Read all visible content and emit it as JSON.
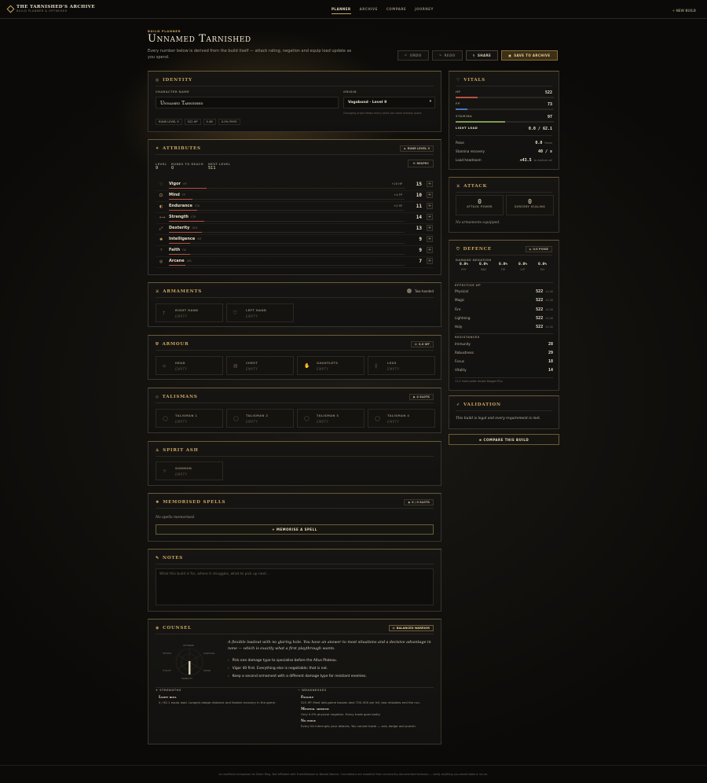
{
  "brand": {
    "title": "The Tarnished's Archive",
    "subtitle": "Build Planner & Optimiser"
  },
  "nav": {
    "links": [
      "Planner",
      "Archive",
      "Compare",
      "Journey"
    ],
    "active": "Planner",
    "new_build": "New Build"
  },
  "header": {
    "eyebrow": "Build Planner",
    "title": "Unnamed Tarnished",
    "lede": "Every number below is derived from the build itself — attack rating, negation and equip load update as you spend.",
    "buttons": {
      "undo": "Undo",
      "redo": "Redo",
      "share": "Share",
      "save": "Save to Archive"
    }
  },
  "identity": {
    "title": "Identity",
    "name_label": "Character Name",
    "name_value": "Unnamed Tarnished",
    "origin_label": "Origin",
    "origin_value": "Vagabond · Level 9",
    "origin_hint": "Changing origin keeps every point you have already spent.",
    "chips": [
      "Rune Level 9",
      "522 HP",
      "0 AR",
      "0.0% Phys"
    ]
  },
  "attributes": {
    "title": "Attributes",
    "badge": "Rune Level 9",
    "level_label": "Level",
    "level_value": "9",
    "runes_label": "Runes to reach",
    "runes_value": "0",
    "next_label": "Next level",
    "next_value": "511",
    "respec": "Respec",
    "rows": [
      {
        "name": "Vigor",
        "sub": "HP",
        "bonus": "+25 HP",
        "value": "15",
        "fill": 0.16
      },
      {
        "name": "Mind",
        "sub": "FP",
        "bonus": "+4 FP",
        "value": "10",
        "fill": 0.1
      },
      {
        "name": "Endurance",
        "sub": "STA",
        "bonus": "+2 SP",
        "value": "11",
        "fill": 0.12
      },
      {
        "name": "Strength",
        "sub": "STR",
        "bonus": "",
        "value": "14",
        "fill": 0.15
      },
      {
        "name": "Dexterity",
        "sub": "DEX",
        "bonus": "",
        "value": "13",
        "fill": 0.14
      },
      {
        "name": "Intelligence",
        "sub": "INT",
        "bonus": "",
        "value": "9",
        "fill": 0.09
      },
      {
        "name": "Faith",
        "sub": "FAI",
        "bonus": "",
        "value": "9",
        "fill": 0.09
      },
      {
        "name": "Arcane",
        "sub": "ARC",
        "bonus": "",
        "value": "7",
        "fill": 0.07
      }
    ]
  },
  "armaments": {
    "title": "Armaments",
    "toggle": "Two-handed",
    "slots": [
      {
        "name": "Right Hand",
        "value": "Empty"
      },
      {
        "name": "Left Hand",
        "value": "Empty"
      }
    ]
  },
  "armour": {
    "title": "Armour",
    "badge": "0.0 WT",
    "slots": [
      {
        "name": "Head",
        "value": "Empty"
      },
      {
        "name": "Chest",
        "value": "Empty"
      },
      {
        "name": "Gauntlets",
        "value": "Empty"
      },
      {
        "name": "Legs",
        "value": "Empty"
      }
    ]
  },
  "talismans": {
    "title": "Talismans",
    "badge": "4 Slots",
    "slots": [
      {
        "name": "Talisman 1",
        "value": "Empty"
      },
      {
        "name": "Talisman 2",
        "value": "Empty"
      },
      {
        "name": "Talisman 3",
        "value": "Empty"
      },
      {
        "name": "Talisman 4",
        "value": "Empty"
      }
    ]
  },
  "spirit": {
    "title": "Spirit Ash",
    "slot": {
      "name": "Summon",
      "value": "Empty"
    }
  },
  "spells": {
    "title": "Memorised Spells",
    "badge": "0 / 0 Slots",
    "empty": "No spells memorised.",
    "button": "+ Memorise a Spell"
  },
  "notes": {
    "title": "Notes",
    "placeholder": "What this build is for, where it struggles, what to pick up next..."
  },
  "counsel": {
    "title": "Counsel",
    "badge": "Balanced Warrior",
    "intro": "A flexible loadout with no glaring hole. You have an answer to most situations and a decisive advantage in none — which is exactly what a first playthrough wants.",
    "radar": [
      "Offense",
      "Survival",
      "Poise",
      "Mobility",
      "Utility",
      "Status"
    ],
    "tips": [
      "Pick one damage type to specialise before the Altus Plateau.",
      "Vigor 40 first. Everything else is negotiable; that is not.",
      "Keep a second armament with a different damage type for resistant enemies."
    ],
    "strengths_label": "Strengths",
    "weaknesses_label": "Weaknesses",
    "strengths": [
      {
        "h": "Light roll",
        "d": "0 / 62.1 equip load. Longest dodge distance and fastest recovery in the game."
      }
    ],
    "weaknesses": [
      {
        "h": "Fragile",
        "d": "522 HP. Most late-game bosses deal 700–900 per hit; two mistakes end the run."
      },
      {
        "h": "Minimal armour",
        "d": "Only 0.0% physical negation. Every trade goes badly."
      },
      {
        "h": "No poise",
        "d": "Every hit interrupts your attacks. You cannot trade — only dodge and punish."
      }
    ]
  },
  "vitals": {
    "title": "Vitals",
    "hp_label": "HP",
    "hp": "522",
    "fp_label": "FP",
    "fp": "73",
    "st_label": "Stamina",
    "st": "97",
    "load_label": "Light Load",
    "load": "0.0 / 62.1",
    "poise_label": "Poise",
    "poise": "0.0",
    "poise_unit": "Points",
    "stamrec_label": "Stamina recovery",
    "stamrec": "40 / s",
    "headroom_label": "Load headroom",
    "headroom": "+43.5",
    "headroom_unit": "to medium roll",
    "hp_fill": 0.22,
    "fp_fill": 0.12,
    "st_fill": 0.5
  },
  "attack": {
    "title": "Attack",
    "ap": "0",
    "ap_label": "Attack Power",
    "sc": "0",
    "sc_label": "Sorcery Scaling",
    "empty": "No armaments equipped."
  },
  "defence": {
    "title": "Defence",
    "badge": "0.0 Poise",
    "neg_label": "Damage Negation",
    "neg": [
      {
        "v": "0.0%",
        "l": "PHY"
      },
      {
        "v": "0.0%",
        "l": "MAG"
      },
      {
        "v": "0.0%",
        "l": "FIR"
      },
      {
        "v": "0.0%",
        "l": "LHT"
      },
      {
        "v": "0.0%",
        "l": "HLY"
      }
    ],
    "ehp_label": "Effective HP",
    "ehp": [
      {
        "k": "Physical",
        "v": "522",
        "m": "×1.00"
      },
      {
        "k": "Magic",
        "v": "522",
        "m": "×1.00"
      },
      {
        "k": "Fire",
        "v": "522",
        "m": "×1.00"
      },
      {
        "k": "Lightning",
        "v": "522",
        "m": "×1.00"
      },
      {
        "k": "Holy",
        "v": "522",
        "m": "×1.00"
      }
    ],
    "res_label": "Resistances",
    "res": [
      {
        "k": "Immunity",
        "v": "28"
      },
      {
        "k": "Robustness",
        "v": "29"
      },
      {
        "k": "Focus",
        "v": "18"
      },
      {
        "k": "Vitality",
        "v": "14"
      }
    ],
    "foot": "11.0 more poise resists Dagger R1s."
  },
  "validation": {
    "title": "Validation",
    "text": "This build is legal and every requirement is met.",
    "compare": "Compare This Build"
  },
  "footer": "An unofficial companion for Elden Ring. Not affiliated with FromSoftware or Bandai Namco. Calculations are modelled from community-documented formulae — verify anything you would stake a run on.",
  "colors": {
    "accent": "#c9a45c",
    "hp": "#b2533f",
    "fp": "#4f73b8",
    "stamina": "#7d9a4e"
  }
}
